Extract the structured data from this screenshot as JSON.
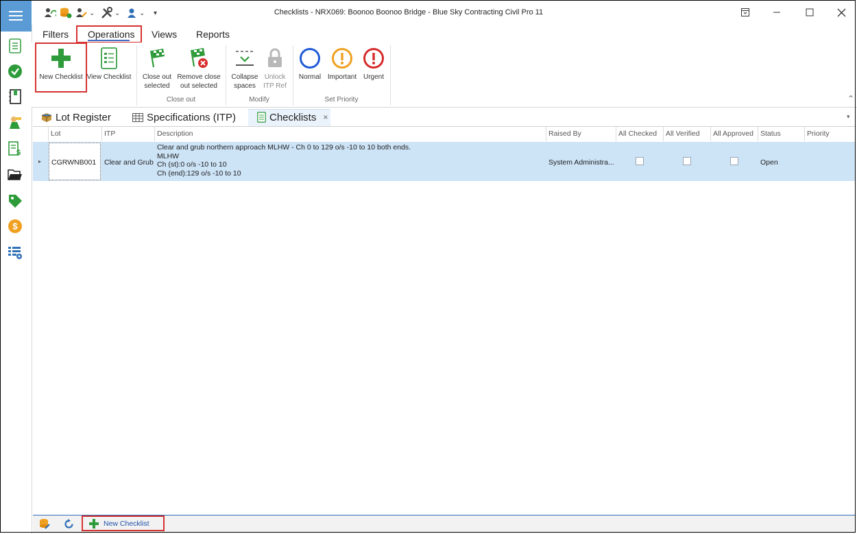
{
  "window": {
    "title": "Checklists - NRX069: Boonoo Boonoo Bridge  - Blue Sky Contracting Civil Pro 11"
  },
  "ribbon_tabs": [
    "Filters",
    "Operations",
    "Views",
    "Reports"
  ],
  "ribbon": {
    "new_checklist": "New Checklist",
    "view_checklist": "View Checklist",
    "close_out_selected": [
      "Close out",
      "selected"
    ],
    "remove_close_out_selected": [
      "Remove close",
      "out selected"
    ],
    "collapse_spaces": [
      "Collapse",
      "spaces"
    ],
    "unlock_itp_ref": [
      "Unlock",
      "ITP Ref"
    ],
    "priority_normal": "Normal",
    "priority_important": "Important",
    "priority_urgent": "Urgent",
    "groups": {
      "close_out": "Close out",
      "modify": "Modify",
      "set_priority": "Set Priority"
    }
  },
  "doc_tabs": {
    "lot_register": "Lot Register",
    "specifications": "Specifications (ITP)",
    "checklists": "Checklists",
    "close_glyph": "×"
  },
  "grid": {
    "columns": [
      "Lot",
      "ITP",
      "Description",
      "Raised By",
      "All Checked",
      "All Verified",
      "All Approved",
      "Status",
      "Priority"
    ],
    "rows": [
      {
        "lot": "CGRWNB001",
        "itp": "Clear and Grub",
        "description": [
          "Clear and grub northern approach MLHW - Ch 0 to 129  o/s -10 to 10 both ends.",
          "MLHW",
          "Ch (st):0 o/s -10 to 10",
          "Ch (end):129 o/s -10 to 10"
        ],
        "raised_by": "System Administra...",
        "status": "Open",
        "priority": ""
      }
    ]
  },
  "bottom_bar": {
    "new_checklist": "New Checklist"
  },
  "colors": {
    "accent_blue": "#5b9bd5",
    "highlight_red": "#d63030",
    "row_selected": "#cde3f6",
    "green": "#2e9b3a",
    "normal_blue": "#1f5bd6",
    "important_orange": "#f0a020",
    "urgent_red": "#d62b2b"
  }
}
